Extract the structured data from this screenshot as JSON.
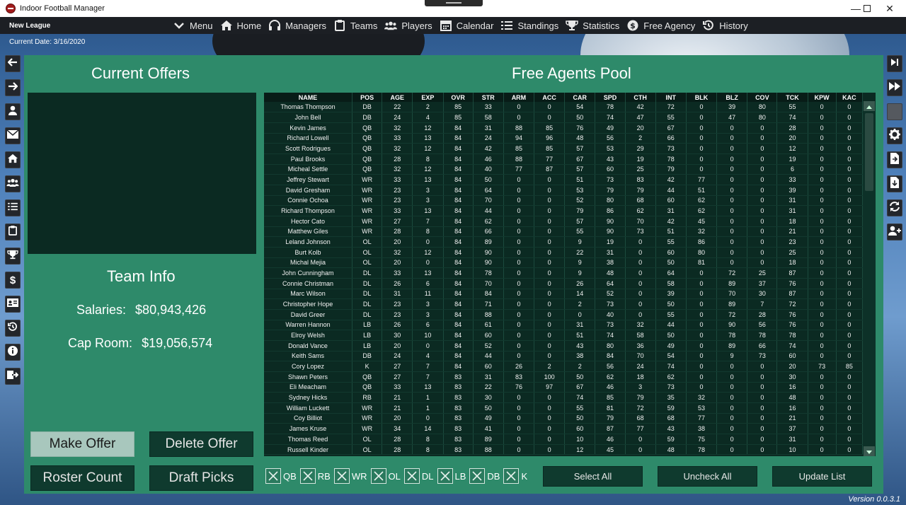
{
  "window": {
    "title": "Indoor Football Manager"
  },
  "nav": {
    "league": "New League",
    "items": [
      {
        "label": "Menu",
        "icon": "chevron-down-icon"
      },
      {
        "label": "Home",
        "icon": "home-icon"
      },
      {
        "label": "Managers",
        "icon": "headset-icon"
      },
      {
        "label": "Teams",
        "icon": "clipboard-icon"
      },
      {
        "label": "Players",
        "icon": "users-icon"
      },
      {
        "label": "Calendar",
        "icon": "calendar-icon"
      },
      {
        "label": "Standings",
        "icon": "list-icon"
      },
      {
        "label": "Statistics",
        "icon": "trophy-icon"
      },
      {
        "label": "Free Agency",
        "icon": "dollar-icon"
      },
      {
        "label": "History",
        "icon": "history-icon"
      }
    ]
  },
  "status": {
    "current_date": "Current Date: 3/16/2020",
    "version": "Version 0.0.3.1"
  },
  "offers": {
    "title": "Current Offers",
    "team_info_title": "Team Info",
    "salaries_label": "Salaries:",
    "salaries_value": "$80,943,426",
    "cap_room_label": "Cap Room:",
    "cap_room_value": "$19,056,574",
    "buttons": {
      "make_offer": "Make Offer",
      "delete_offer": "Delete Offer",
      "roster_count": "Roster Count",
      "draft_picks": "Draft Picks"
    }
  },
  "pool": {
    "title": "Free Agents Pool",
    "columns": [
      "NAME",
      "POS",
      "AGE",
      "EXP",
      "OVR",
      "STR",
      "ARM",
      "ACC",
      "CAR",
      "SPD",
      "CTH",
      "INT",
      "BLK",
      "BLZ",
      "COV",
      "TCK",
      "KPW",
      "KAC"
    ],
    "rows": [
      [
        "Thomas Thompson",
        "DB",
        "22",
        "2",
        "85",
        "33",
        "0",
        "0",
        "54",
        "78",
        "42",
        "72",
        "0",
        "39",
        "80",
        "55",
        "0",
        "0"
      ],
      [
        "John Bell",
        "DB",
        "24",
        "4",
        "85",
        "58",
        "0",
        "0",
        "50",
        "74",
        "47",
        "55",
        "0",
        "47",
        "80",
        "74",
        "0",
        "0"
      ],
      [
        "Kevin James",
        "QB",
        "32",
        "12",
        "84",
        "31",
        "88",
        "85",
        "76",
        "49",
        "20",
        "67",
        "0",
        "0",
        "0",
        "28",
        "0",
        "0"
      ],
      [
        "Richard Lowell",
        "QB",
        "33",
        "13",
        "84",
        "24",
        "94",
        "96",
        "48",
        "56",
        "2",
        "66",
        "0",
        "0",
        "0",
        "20",
        "0",
        "0"
      ],
      [
        "Scott Rodrigues",
        "QB",
        "32",
        "12",
        "84",
        "42",
        "85",
        "85",
        "57",
        "53",
        "29",
        "73",
        "0",
        "0",
        "0",
        "12",
        "0",
        "0"
      ],
      [
        "Paul Brooks",
        "QB",
        "28",
        "8",
        "84",
        "46",
        "88",
        "77",
        "67",
        "43",
        "19",
        "78",
        "0",
        "0",
        "0",
        "19",
        "0",
        "0"
      ],
      [
        "Micheal Settle",
        "QB",
        "32",
        "12",
        "84",
        "40",
        "77",
        "87",
        "57",
        "60",
        "25",
        "79",
        "0",
        "0",
        "0",
        "6",
        "0",
        "0"
      ],
      [
        "Jeffrey Stewart",
        "WR",
        "33",
        "13",
        "84",
        "50",
        "0",
        "0",
        "51",
        "73",
        "83",
        "42",
        "77",
        "0",
        "0",
        "33",
        "0",
        "0"
      ],
      [
        "David Gresham",
        "WR",
        "23",
        "3",
        "84",
        "64",
        "0",
        "0",
        "53",
        "79",
        "79",
        "44",
        "51",
        "0",
        "0",
        "39",
        "0",
        "0"
      ],
      [
        "Connie Ochoa",
        "WR",
        "23",
        "3",
        "84",
        "70",
        "0",
        "0",
        "52",
        "80",
        "68",
        "60",
        "62",
        "0",
        "0",
        "31",
        "0",
        "0"
      ],
      [
        "Richard Thompson",
        "WR",
        "33",
        "13",
        "84",
        "44",
        "0",
        "0",
        "79",
        "86",
        "62",
        "31",
        "62",
        "0",
        "0",
        "31",
        "0",
        "0"
      ],
      [
        "Hector Cato",
        "WR",
        "27",
        "7",
        "84",
        "62",
        "0",
        "0",
        "57",
        "90",
        "70",
        "42",
        "45",
        "0",
        "0",
        "18",
        "0",
        "0"
      ],
      [
        "Matthew Giles",
        "WR",
        "28",
        "8",
        "84",
        "66",
        "0",
        "0",
        "55",
        "90",
        "73",
        "51",
        "32",
        "0",
        "0",
        "21",
        "0",
        "0"
      ],
      [
        "Leland Johnson",
        "OL",
        "20",
        "0",
        "84",
        "89",
        "0",
        "0",
        "9",
        "19",
        "0",
        "55",
        "86",
        "0",
        "0",
        "23",
        "0",
        "0"
      ],
      [
        "Burt Kolb",
        "OL",
        "32",
        "12",
        "84",
        "90",
        "0",
        "0",
        "22",
        "31",
        "0",
        "60",
        "80",
        "0",
        "0",
        "25",
        "0",
        "0"
      ],
      [
        "Michal Mejia",
        "OL",
        "20",
        "0",
        "84",
        "90",
        "0",
        "0",
        "9",
        "38",
        "0",
        "50",
        "81",
        "0",
        "0",
        "18",
        "0",
        "0"
      ],
      [
        "John Cunningham",
        "DL",
        "33",
        "13",
        "84",
        "78",
        "0",
        "0",
        "9",
        "48",
        "0",
        "64",
        "0",
        "72",
        "25",
        "87",
        "0",
        "0"
      ],
      [
        "Connie Christman",
        "DL",
        "26",
        "6",
        "84",
        "70",
        "0",
        "0",
        "26",
        "64",
        "0",
        "58",
        "0",
        "89",
        "37",
        "76",
        "0",
        "0"
      ],
      [
        "Marc Wilson",
        "DL",
        "31",
        "11",
        "84",
        "84",
        "0",
        "0",
        "14",
        "52",
        "0",
        "39",
        "0",
        "70",
        "30",
        "87",
        "0",
        "0"
      ],
      [
        "Christopher Hope",
        "DL",
        "23",
        "3",
        "84",
        "71",
        "0",
        "0",
        "2",
        "73",
        "0",
        "50",
        "0",
        "89",
        "7",
        "72",
        "0",
        "0"
      ],
      [
        "David Greer",
        "DL",
        "23",
        "3",
        "84",
        "88",
        "0",
        "0",
        "0",
        "40",
        "0",
        "55",
        "0",
        "72",
        "28",
        "76",
        "0",
        "0"
      ],
      [
        "Warren Hannon",
        "LB",
        "26",
        "6",
        "84",
        "61",
        "0",
        "0",
        "31",
        "73",
        "32",
        "44",
        "0",
        "90",
        "56",
        "76",
        "0",
        "0"
      ],
      [
        "Elroy Welsh",
        "LB",
        "30",
        "10",
        "84",
        "60",
        "0",
        "0",
        "51",
        "74",
        "58",
        "50",
        "0",
        "78",
        "78",
        "78",
        "0",
        "0"
      ],
      [
        "Donald Vance",
        "LB",
        "20",
        "0",
        "84",
        "52",
        "0",
        "0",
        "43",
        "80",
        "36",
        "49",
        "0",
        "89",
        "66",
        "74",
        "0",
        "0"
      ],
      [
        "Keith Sams",
        "DB",
        "24",
        "4",
        "84",
        "44",
        "0",
        "0",
        "38",
        "84",
        "70",
        "54",
        "0",
        "9",
        "73",
        "60",
        "0",
        "0"
      ],
      [
        "Cory Lopez",
        "K",
        "27",
        "7",
        "84",
        "60",
        "26",
        "2",
        "2",
        "56",
        "24",
        "74",
        "0",
        "0",
        "0",
        "20",
        "73",
        "85"
      ],
      [
        "Shawn Peters",
        "QB",
        "27",
        "7",
        "83",
        "31",
        "83",
        "100",
        "50",
        "62",
        "18",
        "62",
        "0",
        "0",
        "0",
        "30",
        "0",
        "0"
      ],
      [
        "Eli Meacham",
        "QB",
        "33",
        "13",
        "83",
        "22",
        "76",
        "97",
        "67",
        "46",
        "3",
        "73",
        "0",
        "0",
        "0",
        "16",
        "0",
        "0"
      ],
      [
        "Sydney Hicks",
        "RB",
        "21",
        "1",
        "83",
        "30",
        "0",
        "0",
        "74",
        "85",
        "79",
        "35",
        "32",
        "0",
        "0",
        "48",
        "0",
        "0"
      ],
      [
        "William Luckett",
        "WR",
        "21",
        "1",
        "83",
        "50",
        "0",
        "0",
        "55",
        "81",
        "72",
        "59",
        "53",
        "0",
        "0",
        "16",
        "0",
        "0"
      ],
      [
        "Coy Billiot",
        "WR",
        "20",
        "0",
        "83",
        "49",
        "0",
        "0",
        "50",
        "79",
        "68",
        "68",
        "77",
        "0",
        "0",
        "21",
        "0",
        "0"
      ],
      [
        "James Kruse",
        "WR",
        "34",
        "14",
        "83",
        "41",
        "0",
        "0",
        "60",
        "87",
        "77",
        "43",
        "38",
        "0",
        "0",
        "37",
        "0",
        "0"
      ],
      [
        "Thomas Reed",
        "OL",
        "28",
        "8",
        "83",
        "89",
        "0",
        "0",
        "10",
        "46",
        "0",
        "59",
        "75",
        "0",
        "0",
        "31",
        "0",
        "0"
      ],
      [
        "Russell Kinder",
        "OL",
        "28",
        "8",
        "83",
        "88",
        "0",
        "0",
        "12",
        "45",
        "0",
        "48",
        "78",
        "0",
        "0",
        "10",
        "0",
        "0"
      ]
    ]
  },
  "filters": [
    "QB",
    "RB",
    "WR",
    "OL",
    "DL",
    "LB",
    "DB",
    "K"
  ],
  "pool_buttons": {
    "select_all": "Select All",
    "uncheck_all": "Uncheck All",
    "update_list": "Update List"
  },
  "colors": {
    "panel": "#2e8a6a",
    "dark_box": "#0b2a22",
    "button": "#0f3a2e",
    "navbar": "#1c1f24"
  },
  "left_sidebar_icons": [
    "arrow-left-icon",
    "arrow-right-icon",
    "user-icon",
    "envelope-icon",
    "home-icon",
    "users-icon",
    "list-icon",
    "clipboard-icon",
    "trophy-icon",
    "dollar-icon",
    "id-card-icon",
    "history-icon",
    "info-icon",
    "export-icon"
  ],
  "right_sidebar_icons": [
    "skip-end-icon",
    "fast-forward-icon",
    "blank-icon",
    "gear-icon",
    "file-import-icon",
    "file-download-icon",
    "refresh-icon",
    "add-user-icon"
  ]
}
